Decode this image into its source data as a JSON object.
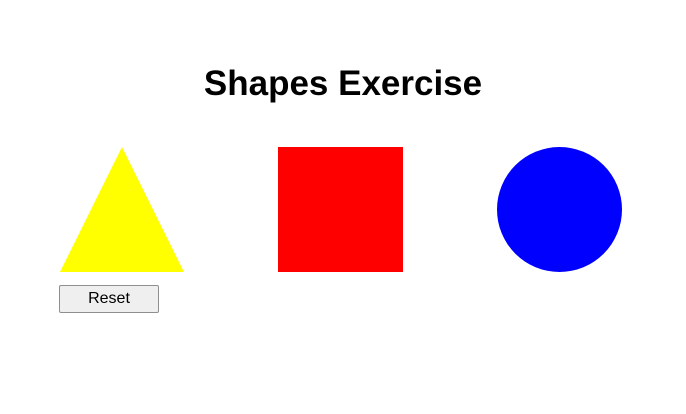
{
  "page": {
    "title": "Shapes Exercise"
  },
  "shapes": [
    {
      "type": "triangle",
      "color": "#ffff00"
    },
    {
      "type": "square",
      "color": "#ff0000"
    },
    {
      "type": "circle",
      "color": "#0000ff"
    }
  ],
  "controls": {
    "reset_label": "Reset"
  }
}
